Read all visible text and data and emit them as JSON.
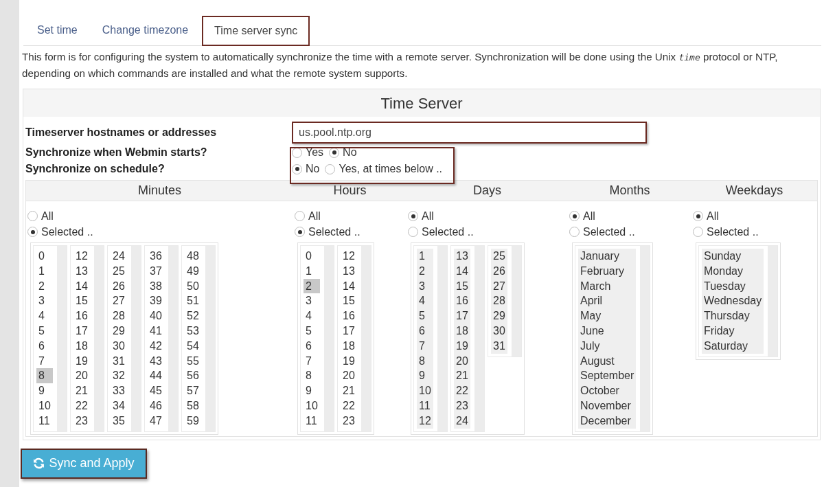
{
  "tabs": [
    {
      "label": "Set time",
      "selected": false
    },
    {
      "label": "Change timezone",
      "selected": false
    },
    {
      "label": "Time server sync",
      "selected": true
    }
  ],
  "description": "This form is for configuring the system to automatically synchronize the time with a remote server. Synchronization will be done using the Unix *time* protocol or NTP, depending on which commands are installed and what the remote system supports.",
  "form": {
    "title": "Time Server",
    "fields": [
      {
        "kind": "text",
        "label": "Timeserver hostnames or addresses",
        "value": "us.pool.ntp.org"
      },
      {
        "kind": "radio",
        "label": "Synchronize when Webmin starts?",
        "options": [
          {
            "label": "Yes",
            "selected": false
          },
          {
            "label": "No",
            "selected": true
          }
        ]
      },
      {
        "kind": "radio",
        "label": "Synchronize on schedule?",
        "options": [
          {
            "label": "No",
            "selected": true
          },
          {
            "label": "Yes, at times below ..",
            "selected": false
          }
        ]
      }
    ]
  },
  "schedule": {
    "columns": [
      {
        "title": "Minutes",
        "options": [
          {
            "label": "All",
            "selected": false
          },
          {
            "label": "Selected ..",
            "selected": true
          }
        ],
        "lists": [
          [
            {
              "text": "0",
              "selected": false
            },
            {
              "text": "1",
              "selected": false
            },
            {
              "text": "2",
              "selected": false
            },
            {
              "text": "3",
              "selected": false
            },
            {
              "text": "4",
              "selected": false
            },
            {
              "text": "5",
              "selected": false
            },
            {
              "text": "6",
              "selected": false
            },
            {
              "text": "7",
              "selected": false
            },
            {
              "text": "8",
              "selected": true
            },
            {
              "text": "9",
              "selected": false
            },
            {
              "text": "10",
              "selected": false
            },
            {
              "text": "11",
              "selected": false
            }
          ],
          [
            {
              "text": "12",
              "selected": false
            },
            {
              "text": "13",
              "selected": false
            },
            {
              "text": "14",
              "selected": false
            },
            {
              "text": "15",
              "selected": false
            },
            {
              "text": "16",
              "selected": false
            },
            {
              "text": "17",
              "selected": false
            },
            {
              "text": "18",
              "selected": false
            },
            {
              "text": "19",
              "selected": false
            },
            {
              "text": "20",
              "selected": false
            },
            {
              "text": "21",
              "selected": false
            },
            {
              "text": "22",
              "selected": false
            },
            {
              "text": "23",
              "selected": false
            }
          ],
          [
            {
              "text": "24",
              "selected": false
            },
            {
              "text": "25",
              "selected": false
            },
            {
              "text": "26",
              "selected": false
            },
            {
              "text": "27",
              "selected": false
            },
            {
              "text": "28",
              "selected": false
            },
            {
              "text": "29",
              "selected": false
            },
            {
              "text": "30",
              "selected": false
            },
            {
              "text": "31",
              "selected": false
            },
            {
              "text": "32",
              "selected": false
            },
            {
              "text": "33",
              "selected": false
            },
            {
              "text": "34",
              "selected": false
            },
            {
              "text": "35",
              "selected": false
            }
          ],
          [
            {
              "text": "36",
              "selected": false
            },
            {
              "text": "37",
              "selected": false
            },
            {
              "text": "38",
              "selected": false
            },
            {
              "text": "39",
              "selected": false
            },
            {
              "text": "40",
              "selected": false
            },
            {
              "text": "41",
              "selected": false
            },
            {
              "text": "42",
              "selected": false
            },
            {
              "text": "43",
              "selected": false
            },
            {
              "text": "44",
              "selected": false
            },
            {
              "text": "45",
              "selected": false
            },
            {
              "text": "46",
              "selected": false
            },
            {
              "text": "47",
              "selected": false
            }
          ],
          [
            {
              "text": "48",
              "selected": false
            },
            {
              "text": "49",
              "selected": false
            },
            {
              "text": "50",
              "selected": false
            },
            {
              "text": "51",
              "selected": false
            },
            {
              "text": "52",
              "selected": false
            },
            {
              "text": "53",
              "selected": false
            },
            {
              "text": "54",
              "selected": false
            },
            {
              "text": "55",
              "selected": false
            },
            {
              "text": "56",
              "selected": false
            },
            {
              "text": "57",
              "selected": false
            },
            {
              "text": "58",
              "selected": false
            },
            {
              "text": "59",
              "selected": false
            }
          ]
        ]
      },
      {
        "title": "Hours",
        "options": [
          {
            "label": "All",
            "selected": false
          },
          {
            "label": "Selected ..",
            "selected": true
          }
        ],
        "lists": [
          [
            {
              "text": "0",
              "selected": false
            },
            {
              "text": "1",
              "selected": false
            },
            {
              "text": "2",
              "selected": true
            },
            {
              "text": "3",
              "selected": false
            },
            {
              "text": "4",
              "selected": false
            },
            {
              "text": "5",
              "selected": false
            },
            {
              "text": "6",
              "selected": false
            },
            {
              "text": "7",
              "selected": false
            },
            {
              "text": "8",
              "selected": false
            },
            {
              "text": "9",
              "selected": false
            },
            {
              "text": "10",
              "selected": false
            },
            {
              "text": "11",
              "selected": false
            }
          ],
          [
            {
              "text": "12",
              "selected": false
            },
            {
              "text": "13",
              "selected": false
            },
            {
              "text": "14",
              "selected": false
            },
            {
              "text": "15",
              "selected": false
            },
            {
              "text": "16",
              "selected": false
            },
            {
              "text": "17",
              "selected": false
            },
            {
              "text": "18",
              "selected": false
            },
            {
              "text": "19",
              "selected": false
            },
            {
              "text": "20",
              "selected": false
            },
            {
              "text": "21",
              "selected": false
            },
            {
              "text": "22",
              "selected": false
            },
            {
              "text": "23",
              "selected": false
            }
          ]
        ]
      },
      {
        "title": "Days",
        "options": [
          {
            "label": "All",
            "selected": true
          },
          {
            "label": "Selected ..",
            "selected": false
          }
        ],
        "lists": [
          [
            {
              "text": "1",
              "selected": false
            },
            {
              "text": "2",
              "selected": false
            },
            {
              "text": "3",
              "selected": false
            },
            {
              "text": "4",
              "selected": false
            },
            {
              "text": "5",
              "selected": false
            },
            {
              "text": "6",
              "selected": false
            },
            {
              "text": "7",
              "selected": false
            },
            {
              "text": "8",
              "selected": false
            },
            {
              "text": "9",
              "selected": false
            },
            {
              "text": "10",
              "selected": false
            },
            {
              "text": "11",
              "selected": false
            },
            {
              "text": "12",
              "selected": false
            }
          ],
          [
            {
              "text": "13",
              "selected": false
            },
            {
              "text": "14",
              "selected": false
            },
            {
              "text": "15",
              "selected": false
            },
            {
              "text": "16",
              "selected": false
            },
            {
              "text": "17",
              "selected": false
            },
            {
              "text": "18",
              "selected": false
            },
            {
              "text": "19",
              "selected": false
            },
            {
              "text": "20",
              "selected": false
            },
            {
              "text": "21",
              "selected": false
            },
            {
              "text": "22",
              "selected": false
            },
            {
              "text": "23",
              "selected": false
            },
            {
              "text": "24",
              "selected": false
            }
          ],
          [
            {
              "text": "25",
              "selected": false
            },
            {
              "text": "26",
              "selected": false
            },
            {
              "text": "27",
              "selected": false
            },
            {
              "text": "28",
              "selected": false
            },
            {
              "text": "29",
              "selected": false
            },
            {
              "text": "30",
              "selected": false
            },
            {
              "text": "31",
              "selected": false
            }
          ]
        ]
      },
      {
        "title": "Months",
        "options": [
          {
            "label": "All",
            "selected": true
          },
          {
            "label": "Selected ..",
            "selected": false
          }
        ],
        "lists": [
          [
            {
              "text": "January",
              "selected": false
            },
            {
              "text": "February",
              "selected": false
            },
            {
              "text": "March",
              "selected": false
            },
            {
              "text": "April",
              "selected": false
            },
            {
              "text": "May",
              "selected": false
            },
            {
              "text": "June",
              "selected": false
            },
            {
              "text": "July",
              "selected": false
            },
            {
              "text": "August",
              "selected": false
            },
            {
              "text": "September",
              "selected": false
            },
            {
              "text": "October",
              "selected": false
            },
            {
              "text": "November",
              "selected": false
            },
            {
              "text": "December",
              "selected": false
            }
          ]
        ]
      },
      {
        "title": "Weekdays",
        "options": [
          {
            "label": "All",
            "selected": true
          },
          {
            "label": "Selected ..",
            "selected": false
          }
        ],
        "lists": [
          [
            {
              "text": "Sunday",
              "selected": false
            },
            {
              "text": "Monday",
              "selected": false
            },
            {
              "text": "Tuesday",
              "selected": false
            },
            {
              "text": "Wednesday",
              "selected": false
            },
            {
              "text": "Thursday",
              "selected": false
            },
            {
              "text": "Friday",
              "selected": false
            },
            {
              "text": "Saturday",
              "selected": false
            }
          ]
        ]
      }
    ]
  },
  "button": {
    "label": "Sync and Apply"
  }
}
